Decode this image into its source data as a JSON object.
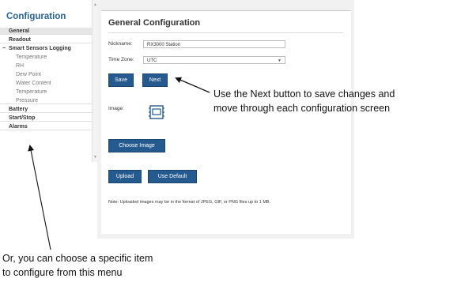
{
  "sidebar": {
    "title": "Configuration",
    "items": [
      {
        "label": "General",
        "level": "top",
        "active": true
      },
      {
        "label": "Readout",
        "level": "top"
      },
      {
        "label": "Smart Sensors Logging",
        "level": "group"
      },
      {
        "label": "Temperature",
        "level": "sub"
      },
      {
        "label": "RH",
        "level": "sub"
      },
      {
        "label": "Dew Point",
        "level": "sub"
      },
      {
        "label": "Water Content",
        "level": "sub"
      },
      {
        "label": "Temperature",
        "level": "sub"
      },
      {
        "label": "Pressure",
        "level": "sub"
      },
      {
        "label": "Battery",
        "level": "top"
      },
      {
        "label": "Start/Stop",
        "level": "top"
      },
      {
        "label": "Alarms",
        "level": "top"
      }
    ],
    "collapse_glyph": "−"
  },
  "main": {
    "title": "General Configuration",
    "nickname_label": "Nickname:",
    "nickname_value": "RX3000 Station",
    "timezone_label": "Time Zone:",
    "timezone_value": "UTC",
    "save_label": "Save",
    "next_label": "Next",
    "image_label": "Image:",
    "image_icon": "device-icon",
    "choose_image_label": "Choose Image",
    "upload_label": "Upload",
    "use_default_label": "Use Default",
    "note": "Note: Uploaded images may be in the format of JPEG, GIF, or PNG files up to 1 MB."
  },
  "callouts": {
    "next_line1": "Use the Next button to save changes and",
    "next_line2": "move through each configuration screen",
    "menu_line1": "Or, you can choose a specific item",
    "menu_line2": "to configure from this menu"
  },
  "colors": {
    "accent": "#245a8e",
    "title_blue": "#2a6496"
  }
}
